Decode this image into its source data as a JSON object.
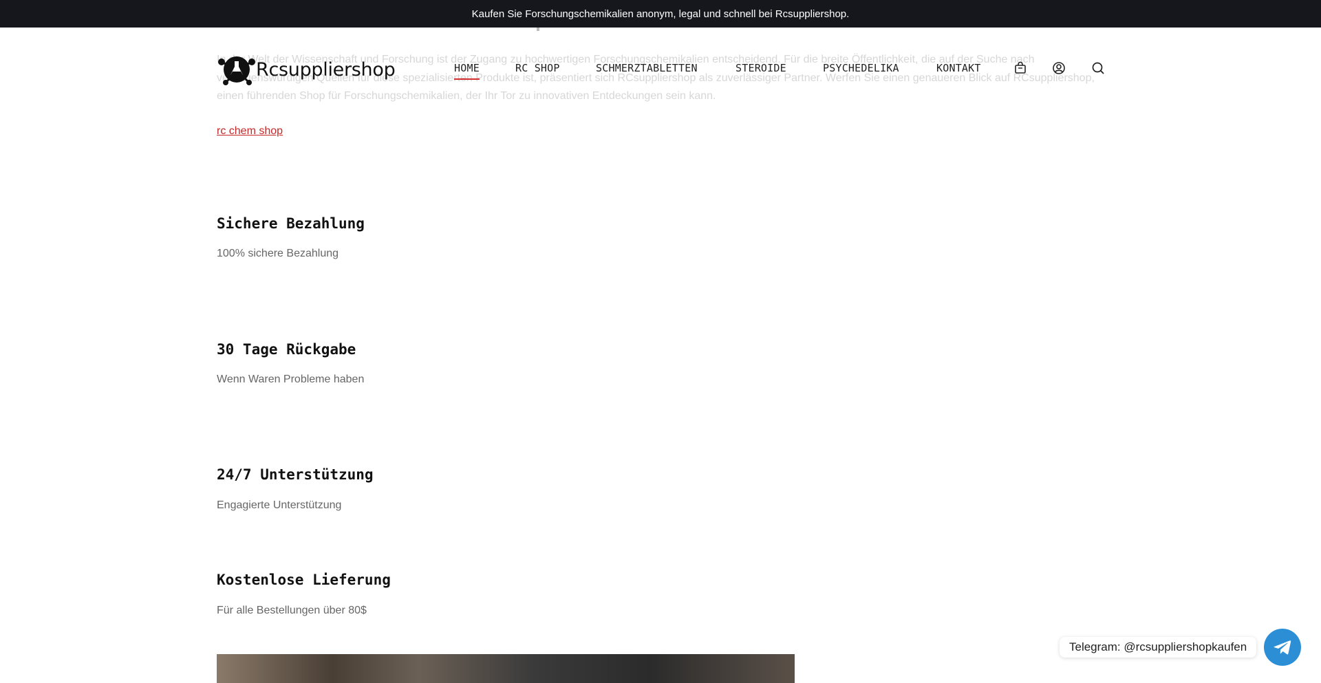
{
  "announcement": "Kaufen Sie Forschungschemikalien anonym, legal und schnell bei Rcsuppliershop.",
  "background_text": "In der Welt der Wissenschaft und Forschung ist der Zugang zu hochwertigen Forschungschemikalien entscheidend. Für die breite Öffentlichkeit, die auf der Suche nach vertrauenswürdigen Quellen für diese spezialisierten Produkte ist, präsentiert sich RCsuppliershop als zuverlässiger Partner. Werfen Sie einen genaueren Blick auf RCsuppliershop, einen führenden Shop für Forschungschemikalien, der Ihr Tor zu innovativen Entdeckungen sein kann.",
  "header": {
    "brand": "Rcsuppliershop",
    "nav": [
      "HOME",
      "RC SHOP",
      "SCHMERZTABLETTEN",
      "STEROIDE",
      "PSYCHEDELIKA",
      "KONTAKT"
    ],
    "active_nav": "HOME",
    "icons": [
      "cart-icon",
      "account-icon",
      "search-icon"
    ]
  },
  "link_text": "rc chem shop",
  "features": [
    {
      "title": "Sichere Bezahlung",
      "text": "100% sichere Bezahlung"
    },
    {
      "title": "30 Tage Rückgabe",
      "text": "Wenn Waren Probleme haben"
    },
    {
      "title": "24/7 Unterstützung",
      "text": "Engagierte Unterstützung"
    },
    {
      "title": "Kostenlose Lieferung",
      "text": "Für alle Bestellungen über 80$"
    }
  ],
  "telegram": {
    "label": "Telegram: @rcsuppliershopkaufen",
    "icon": "telegram-icon"
  },
  "colors": {
    "topbar": "#16161d",
    "accent": "#d32f2f",
    "link": "#c62828",
    "telegram": "#2c8fd6"
  }
}
